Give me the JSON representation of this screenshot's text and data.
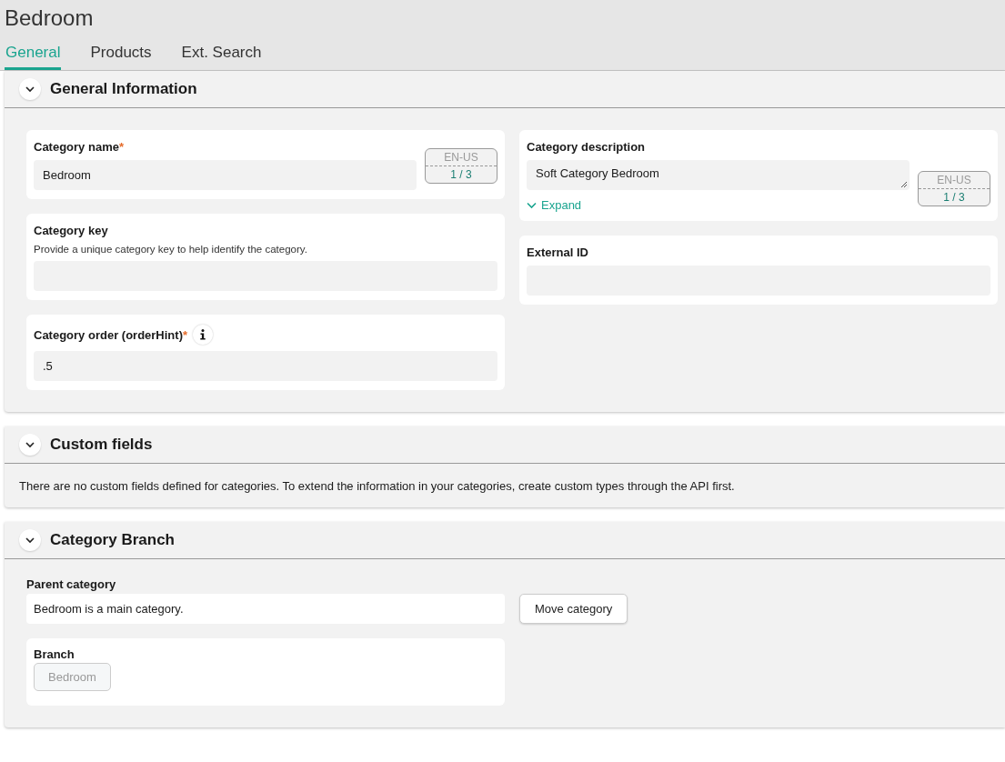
{
  "title": "Bedroom",
  "tabs": [
    {
      "label": "General",
      "selected": true
    },
    {
      "label": "Products",
      "selected": false
    },
    {
      "label": "Ext. Search",
      "selected": false
    }
  ],
  "sections": [
    {
      "kind": "form",
      "title": "General Information",
      "expanded": true,
      "left": [
        {
          "label": "Category name",
          "required_mark": "*",
          "value": "Bedroom",
          "locale": {
            "code": "EN-US",
            "count": "1 / 3"
          }
        },
        {
          "label": "Category key",
          "hint": "Provide a unique category key to help identify the category."
        },
        {
          "label": "Category order (orderHint)",
          "required_mark": "*",
          "info": true,
          "value": ".5"
        }
      ],
      "right": [
        {
          "label": "Category description",
          "multiline": true,
          "value": "Soft Category Bedroom",
          "expand": "Expand",
          "locale": {
            "code": "EN-US",
            "count": "1 / 3"
          }
        },
        {
          "label": "External ID"
        }
      ]
    },
    {
      "kind": "message",
      "title": "Custom fields",
      "expanded": true,
      "message": "There are no custom fields defined for categories. To extend the information in your categories, create custom types through the API first."
    },
    {
      "kind": "branch",
      "title": "Category Branch",
      "expanded": true,
      "parent_label": "Parent category",
      "parent_text": "Bedroom is a main category.",
      "move_button": "Move category",
      "branch_label": "Branch",
      "branch_items": [
        "Bedroom"
      ]
    }
  ]
}
